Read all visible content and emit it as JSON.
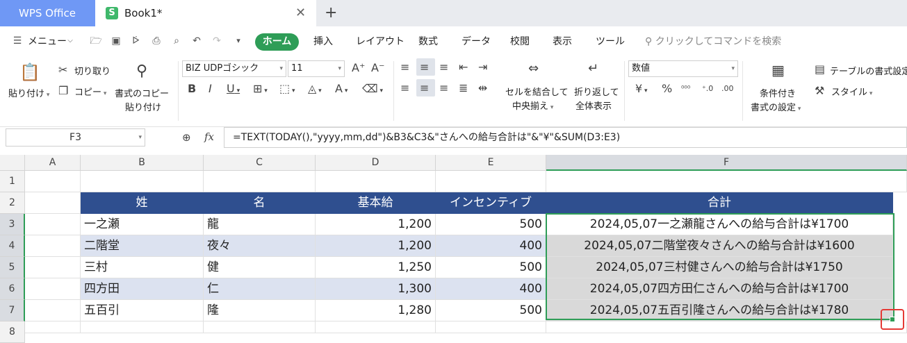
{
  "tabs": {
    "app": "WPS Office",
    "book": "Book1*",
    "logo_letter": "S",
    "close": "✕",
    "new": "+"
  },
  "menu": {
    "menu_label": "メニュー",
    "items": [
      "ホーム",
      "挿入",
      "レイアウト",
      "数式",
      "データ",
      "校閲",
      "表示",
      "ツール"
    ],
    "search": "クリックしてコマンドを検索"
  },
  "ribbon": {
    "paste": "貼り付け",
    "cut": "切り取り",
    "copy": "コピー",
    "format_copy_1": "書式のコピー",
    "format_copy_2": "貼り付け",
    "font_name": "BIZ UDPゴシック",
    "font_size": "11",
    "merge_1": "セルを結合して",
    "merge_2": "中央揃え",
    "wrap_1": "折り返して",
    "wrap_2": "全体表示",
    "number_format": "数値",
    "cond_1": "条件付き",
    "cond_2": "書式の設定",
    "table_format": "テーブルの書式設定",
    "style": "スタイル"
  },
  "formula_bar": {
    "name_box": "F3",
    "formula": "=TEXT(TODAY(),\"yyyy,mm,dd\")&B3&C3&\"さんへの給与合計は\"&\"¥\"&SUM(D3:E3)"
  },
  "columns": [
    "A",
    "B",
    "C",
    "D",
    "E",
    "F"
  ],
  "rows": [
    "1",
    "2",
    "3",
    "4",
    "5",
    "6",
    "7",
    "8"
  ],
  "table": {
    "headers": [
      "姓",
      "名",
      "基本給",
      "インセンティブ",
      "合計"
    ],
    "data": [
      [
        "一之瀬",
        "龍",
        "1,200",
        "500",
        "2024,05,07一之瀬龍さんへの給与合計は¥1700"
      ],
      [
        "二階堂",
        "夜々",
        "1,200",
        "400",
        "2024,05,07二階堂夜々さんへの給与合計は¥1600"
      ],
      [
        "三村",
        "健",
        "1,250",
        "500",
        "2024,05,07三村健さんへの給与合計は¥1750"
      ],
      [
        "四方田",
        "仁",
        "1,300",
        "400",
        "2024,05,07四方田仁さんへの給与合計は¥1700"
      ],
      [
        "五百引",
        "隆",
        "1,280",
        "500",
        "2024,05,07五百引隆さんへの給与合計は¥1780"
      ]
    ]
  },
  "colors": {
    "header_fill": "#2f4f8f",
    "band_fill": "#dce2f0",
    "accent": "#2e9d57",
    "highlight": "#e53935"
  }
}
